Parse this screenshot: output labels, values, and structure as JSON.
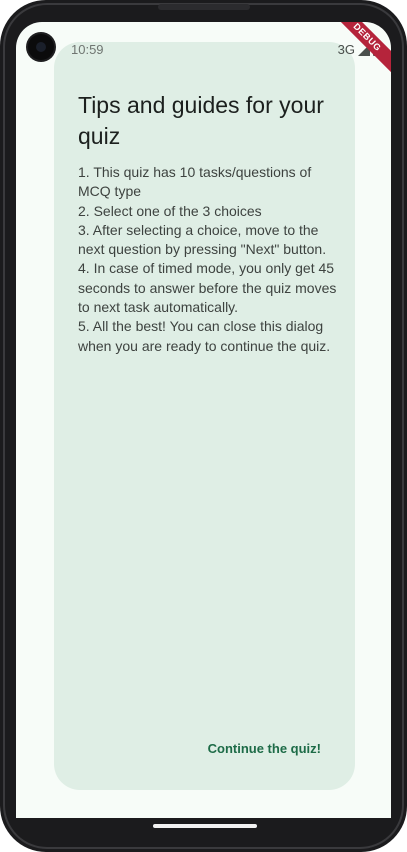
{
  "status_bar": {
    "time": "10:59",
    "network": "3G",
    "icons": [
      "signal-icon",
      "battery-icon"
    ]
  },
  "debug_banner": "DEBUG",
  "dialog": {
    "title": "Tips and guides for your quiz",
    "tips": [
      "1. This quiz has 10 tasks/questions of MCQ type",
      "2. Select one of the 3 choices",
      "3. After selecting a choice, move to the next question by pressing \"Next\" button.",
      "4. In case of timed mode, you only get 45 seconds to answer before the quiz moves to next task automatically.",
      "5. All the best! You can close this dialog when you are ready to continue the quiz."
    ],
    "continue_label": "Continue the quiz!"
  },
  "colors": {
    "screen_background": "#f7fcf8",
    "dialog_background": "#dfeee5",
    "accent": "#1d6b47",
    "debug_banner": "#b5243b"
  }
}
